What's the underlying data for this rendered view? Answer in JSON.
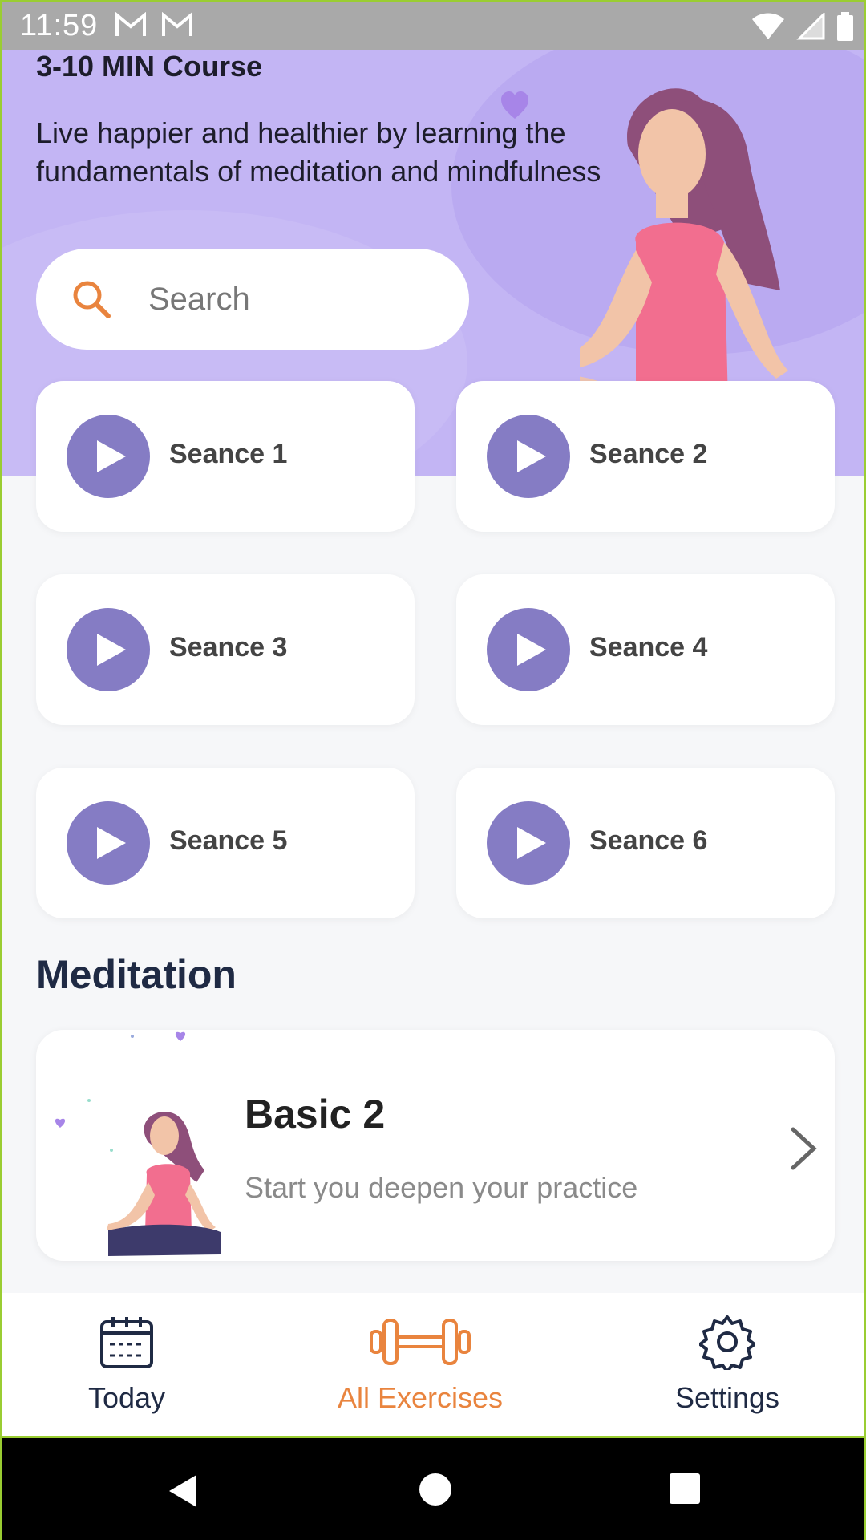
{
  "status_bar": {
    "time": "11:59"
  },
  "hero": {
    "course_title": "3-10 MIN Course",
    "description": "Live happier and healthier by learning the fundamentals of meditation and mindfulness"
  },
  "search": {
    "placeholder": "Search"
  },
  "sessions": [
    {
      "label": "Seance 1"
    },
    {
      "label": "Seance 2"
    },
    {
      "label": "Seance 3"
    },
    {
      "label": "Seance 4"
    },
    {
      "label": "Seance 5"
    },
    {
      "label": "Seance 6"
    }
  ],
  "meditation": {
    "section_title": "Meditation",
    "card": {
      "title": "Basic 2",
      "subtitle": "Start you deepen your practice"
    }
  },
  "bottom_nav": [
    {
      "label": "Today",
      "icon": "calendar-icon",
      "active": false
    },
    {
      "label": "All Exercises",
      "icon": "dumbbell-icon",
      "active": true
    },
    {
      "label": "Settings",
      "icon": "gear-icon",
      "active": false
    }
  ],
  "colors": {
    "hero_bg": "#c3b5f4",
    "play_button": "#857cc4",
    "accent": "#e9843e",
    "nav_text": "#1f2a44"
  }
}
